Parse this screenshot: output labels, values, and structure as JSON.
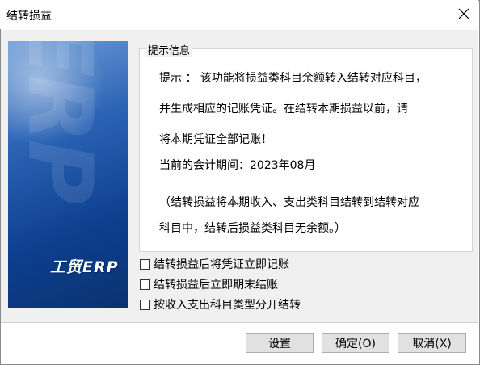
{
  "window": {
    "title": "结转损益"
  },
  "banner": {
    "ghost_text": "ERP",
    "logo_text": "工贸ERP"
  },
  "info_group": {
    "legend": "提示信息",
    "line1": "提示 ：  该功能将损益类科目余额转入结转对应科目，",
    "line2": "并生成相应的记账凭证。在结转本期损益以前，请",
    "line3": "将本期凭证全部记账！",
    "line4": "当前的会计期间：2023年08月",
    "line5": "（结转损益将本期收入、支出类科目结转到结转对应",
    "line6": "科目中，结转后损益类科目无余额。）"
  },
  "options": [
    {
      "label": "结转损益后将凭证立即记账",
      "checked": false
    },
    {
      "label": "结转损益后立即期末结账",
      "checked": false
    },
    {
      "label": "按收入支出科目类型分开结转",
      "checked": false
    }
  ],
  "buttons": {
    "settings": "设置",
    "ok": "确定(O)",
    "cancel": "取消(X)"
  }
}
